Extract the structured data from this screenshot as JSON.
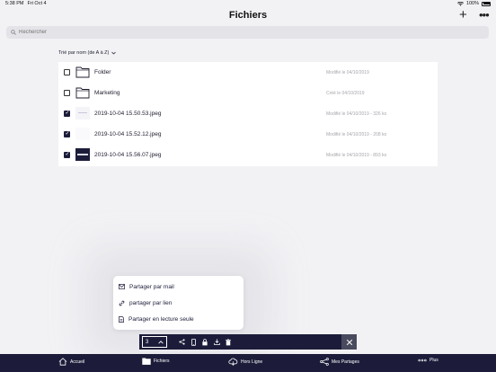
{
  "status_bar": {
    "time": "5:38 PM",
    "date": "Fri Oct 4",
    "battery": "100%"
  },
  "header": {
    "title": "Fichiers",
    "add_icon": "plus-icon",
    "more_icon": "more-icon"
  },
  "search": {
    "placeholder": "Rechercher"
  },
  "sort": {
    "label": "Trié par nom (de A à Z)"
  },
  "files": [
    {
      "name": "Folder",
      "meta": "Modifié le 04/10/2019",
      "checked": false,
      "kind": "folder"
    },
    {
      "name": "Marketing",
      "meta": "Créé le 04/10/2019",
      "checked": false,
      "kind": "folder"
    },
    {
      "name": "2019-10-04 15.50.53.jpeg",
      "meta": "Modifié le 04/10/2019 - 326 ko",
      "checked": true,
      "kind": "image"
    },
    {
      "name": "2019-10-04 15.52.12.jpeg",
      "meta": "Modifié le 04/10/2019 - 208 ko",
      "checked": true,
      "kind": "image"
    },
    {
      "name": "2019-10-04 15.56.07.jpeg",
      "meta": "Modifié le 04/10/2019 - 893 ko",
      "checked": true,
      "kind": "image"
    }
  ],
  "share_menu": {
    "items": [
      {
        "label": "Partager par mail",
        "icon": "mail-icon"
      },
      {
        "label": "partager par lien",
        "icon": "link-icon"
      },
      {
        "label": "Partager en lecture seule",
        "icon": "document-icon"
      }
    ]
  },
  "action_bar": {
    "count": "3"
  },
  "tabs": [
    {
      "label": "Accueil",
      "icon": "home-icon"
    },
    {
      "label": "Fichiers",
      "icon": "folder-icon"
    },
    {
      "label": "Hors Ligne",
      "icon": "cloud-icon"
    },
    {
      "label": "Mes Partages",
      "icon": "share-icon"
    },
    {
      "label": "Plus",
      "icon": "more-icon"
    }
  ],
  "colors": {
    "navy": "#1c1c3a",
    "background": "#f2f2f5",
    "muted": "#a7a7ae"
  }
}
